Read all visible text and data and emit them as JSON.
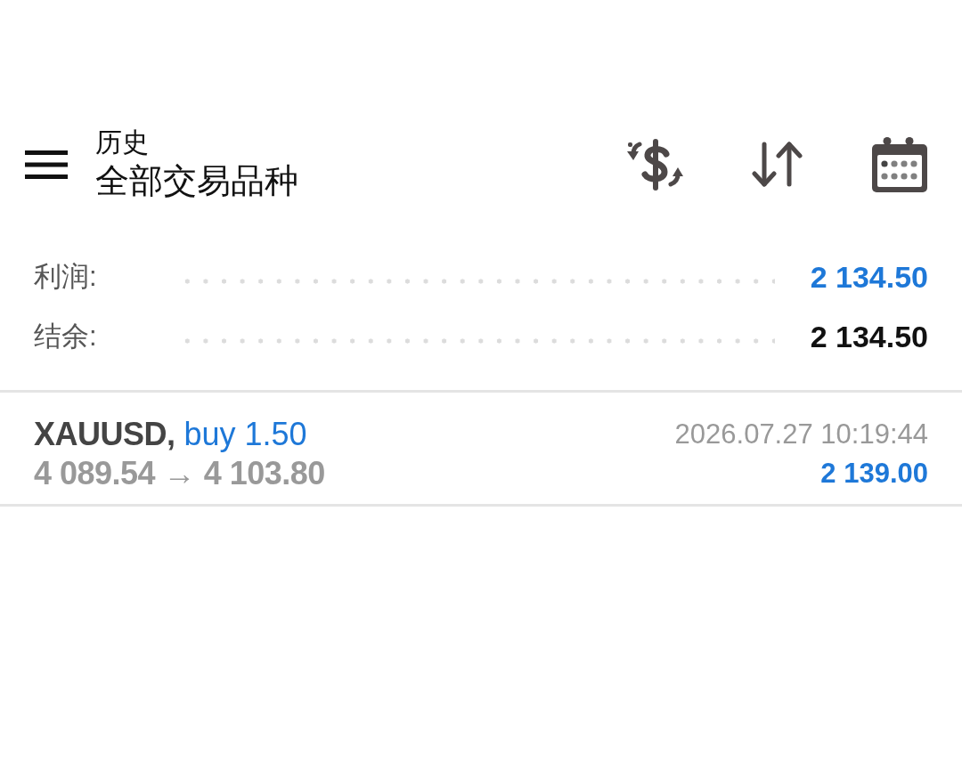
{
  "header": {
    "title": "历史",
    "subtitle": "全部交易品种"
  },
  "summary": [
    {
      "kind": "profit",
      "label": "利润:",
      "value": "2 134.50"
    },
    {
      "kind": "balance",
      "label": "结余:",
      "value": "2 134.50"
    }
  ],
  "trades": [
    {
      "symbol": "XAUUSD,",
      "side": "buy 1.50",
      "prices": "4 089.54 → 4 103.80",
      "time": "2026.07.27 10:19:44",
      "profit": "2 139.00"
    }
  ]
}
